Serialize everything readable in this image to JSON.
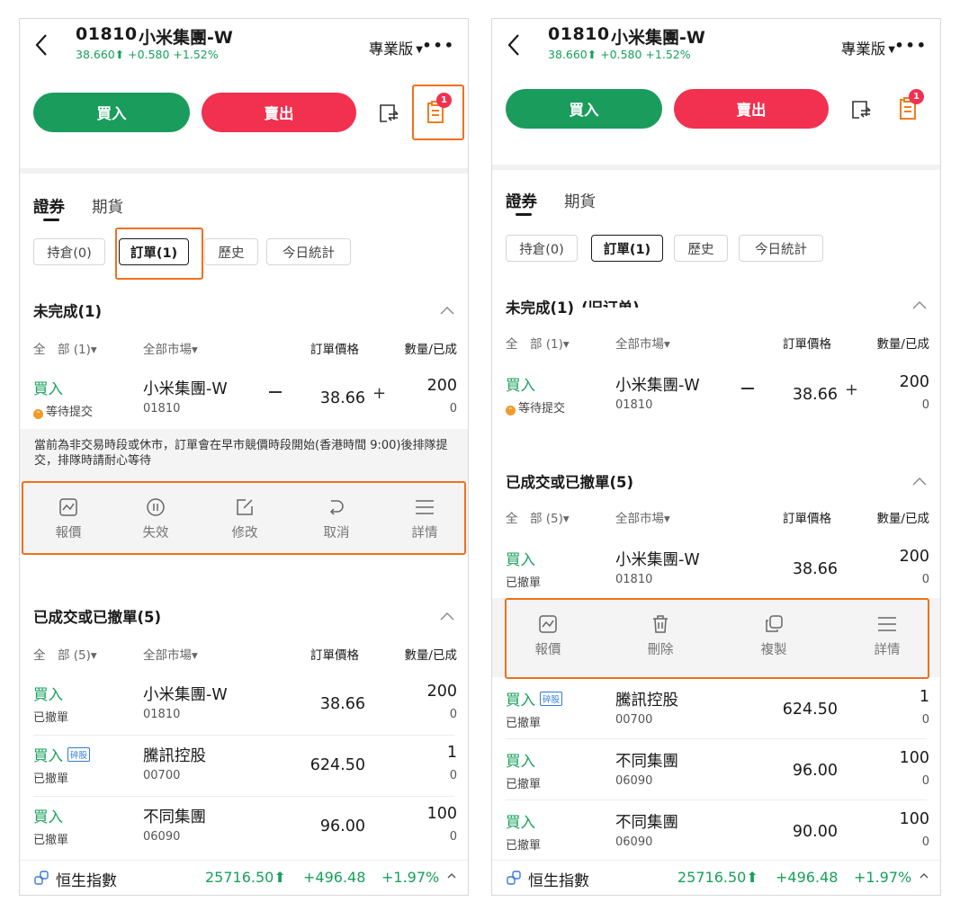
{
  "left": {
    "header": {
      "code": "01810",
      "name": "小米集團-W",
      "quote": "38.660⬆ +0.580 +1.52%",
      "version": "專業版",
      "more": "•••"
    },
    "trade": {
      "buy": "買入",
      "sell": "賣出",
      "order_badge": "1"
    },
    "tabs": {
      "securities": "證券",
      "futures": "期貨"
    },
    "filters": [
      "持倉(0)",
      "訂單(1)",
      "歷史",
      "今日統計"
    ],
    "pending": {
      "title": "未完成(1)",
      "headers": [
        "全　部 (1)▾",
        "全部市場▾",
        "訂單價格",
        "數量/已成"
      ],
      "rows": [
        {
          "side": "買入",
          "status": "等待提交",
          "name": "小米集團-W",
          "code": "01810",
          "price": "38.66",
          "qty": "200",
          "filled": "0"
        }
      ],
      "notice": "當前為非交易時段或休市，訂單會在早市競價時段開始(香港時間 9:00)後排隊提交，排隊時請耐心等待",
      "actions": [
        "報價",
        "失效",
        "修改",
        "取消",
        "詳情"
      ]
    },
    "done": {
      "title": "已成交或已撤單(5)",
      "headers": [
        "全　部 (5)▾",
        "全部市場▾",
        "訂單價格",
        "數量/已成"
      ],
      "rows": [
        {
          "side": "買入",
          "tag": "",
          "status": "已撤單",
          "name": "小米集團-W",
          "code": "01810",
          "price": "38.66",
          "qty": "200",
          "filled": "0"
        },
        {
          "side": "買入",
          "tag": "碎股",
          "status": "已撤單",
          "name": "騰訊控股",
          "code": "00700",
          "price": "624.50",
          "qty": "1",
          "filled": "0"
        },
        {
          "side": "買入",
          "tag": "",
          "status": "已撤單",
          "name": "不同集團",
          "code": "06090",
          "price": "96.00",
          "qty": "100",
          "filled": "0"
        }
      ]
    },
    "footer": {
      "index": "恒生指數",
      "value": "25716.50⬆",
      "change": "+496.48",
      "pct": "+1.97%"
    }
  },
  "right": {
    "header": {
      "code": "01810",
      "name": "小米集團-W",
      "quote": "38.660⬆ +0.580 +1.52%",
      "version": "專業版",
      "more": "•••"
    },
    "trade": {
      "buy": "買入",
      "sell": "賣出",
      "order_badge": "1"
    },
    "tabs": {
      "securities": "證券",
      "futures": "期貨"
    },
    "filters": [
      "持倉(0)",
      "訂單(1)",
      "歷史",
      "今日統計"
    ],
    "pending": {
      "title": "未完成(1)",
      "title_suffix": "(旧订单)",
      "headers": [
        "全　部 (1)▾",
        "全部市場▾",
        "訂單價格",
        "數量/已成"
      ],
      "rows": [
        {
          "side": "買入",
          "status": "等待提交",
          "name": "小米集團-W",
          "code": "01810",
          "price": "38.66",
          "qty": "200",
          "filled": "0"
        }
      ]
    },
    "done": {
      "title": "已成交或已撤單(5)",
      "headers": [
        "全　部 (5)▾",
        "全部市場▾",
        "訂單價格",
        "數量/已成"
      ],
      "rows": [
        {
          "side": "買入",
          "tag": "",
          "status": "已撤單",
          "name": "小米集團-W",
          "code": "01810",
          "price": "38.66",
          "qty": "200",
          "filled": "0"
        },
        {
          "side": "買入",
          "tag": "碎股",
          "status": "已撤單",
          "name": "騰訊控股",
          "code": "00700",
          "price": "624.50",
          "qty": "1",
          "filled": "0"
        },
        {
          "side": "買入",
          "tag": "",
          "status": "已撤單",
          "name": "不同集團",
          "code": "06090",
          "price": "96.00",
          "qty": "100",
          "filled": "0"
        },
        {
          "side": "買入",
          "tag": "",
          "status": "已撤單",
          "name": "不同集團",
          "code": "06090",
          "price": "90.00",
          "qty": "100",
          "filled": "0"
        }
      ],
      "actions": [
        "報價",
        "刪除",
        "複製",
        "詳情"
      ]
    },
    "footer": {
      "index": "恒生指數",
      "value": "25716.50⬆",
      "change": "+496.48",
      "pct": "+1.97%"
    }
  },
  "colors": {
    "green": "#16a15a",
    "buy_button": "#1a9c5c",
    "sell_button": "#f2304f",
    "highlight": "#f0701c",
    "pending_dot": "#f29b2b",
    "tag_blue": "#2f7bd9"
  },
  "icons": [
    "back-chevron-icon",
    "swap-icon",
    "orders-icon",
    "quote-chart-icon",
    "pause-circle-icon",
    "edit-icon",
    "undo-icon",
    "menu-icon",
    "trash-icon",
    "copy-icon",
    "link-icon",
    "chevron-up-icon"
  ]
}
